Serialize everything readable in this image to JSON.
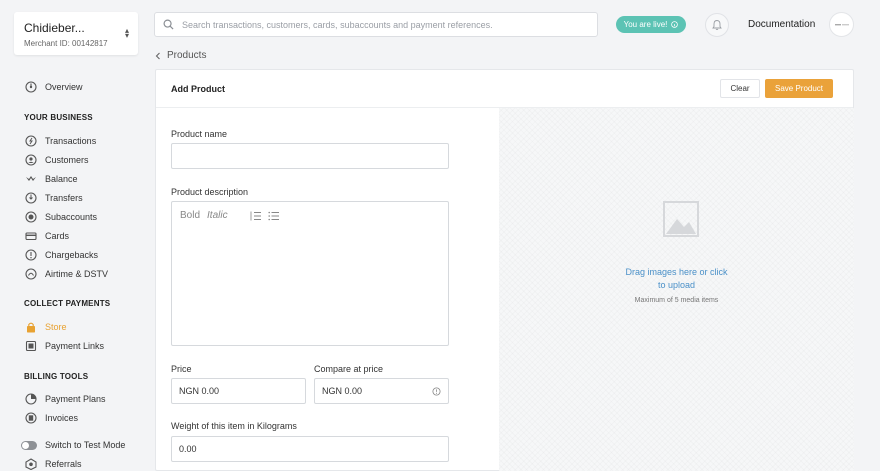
{
  "merchant": {
    "name": "Chidieber...",
    "merchant_id": "Merchant ID: 00142817"
  },
  "search": {
    "placeholder": "Search transactions, customers, cards, subaccounts and payment references."
  },
  "header": {
    "live_label": "You are live!",
    "documentation": "Documentation"
  },
  "breadcrumb": {
    "label": "Products"
  },
  "sidebar": {
    "overview": "Overview",
    "section_business": "YOUR BUSINESS",
    "business_items": [
      "Transactions",
      "Customers",
      "Balance",
      "Transfers",
      "Subaccounts",
      "Cards",
      "Chargebacks",
      "Airtime & DSTV"
    ],
    "section_collect": "COLLECT PAYMENTS",
    "collect_items": [
      "Store",
      "Payment Links"
    ],
    "section_billing": "BILLING TOOLS",
    "billing_items": [
      "Payment Plans",
      "Invoices"
    ],
    "test_mode": "Switch to Test Mode",
    "referrals": "Referrals"
  },
  "card": {
    "title": "Add Product",
    "clear": "Clear",
    "save": "Save Product",
    "product_name_label": "Product name",
    "product_name_value": "",
    "description_label": "Product description",
    "bold": "Bold",
    "italic": "Italic",
    "price_label": "Price",
    "price_value": "NGN 0.00",
    "compare_label": "Compare at price",
    "compare_value": "NGN 0.00",
    "weight_label": "Weight of this item in Kilograms",
    "weight_value": "0.00",
    "upload_text": "Drag images here or click to upload",
    "upload_max": "Maximum of 5 media items"
  },
  "colors": {
    "accent": "#eaa23a",
    "live": "#5cc3b4",
    "link": "#4a90c8"
  }
}
